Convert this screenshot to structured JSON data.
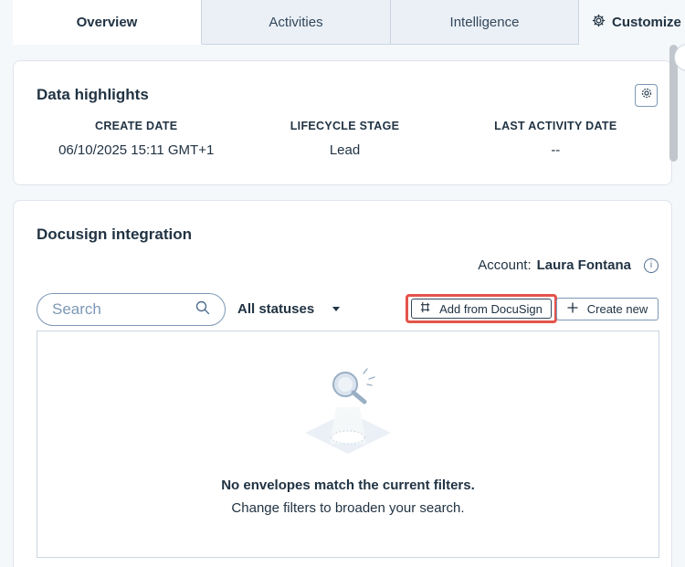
{
  "tabs": [
    {
      "label": "Overview",
      "active": true
    },
    {
      "label": "Activities",
      "active": false
    },
    {
      "label": "Intelligence",
      "active": false
    }
  ],
  "customize": {
    "label": "Customize",
    "icon": "gear-icon"
  },
  "highlights": {
    "title": "Data highlights",
    "columns": [
      {
        "label": "CREATE DATE",
        "value": "06/10/2025 15:11 GMT+1"
      },
      {
        "label": "LIFECYCLE STAGE",
        "value": "Lead"
      },
      {
        "label": "LAST ACTIVITY DATE",
        "value": "--"
      }
    ]
  },
  "docusign": {
    "title": "Docusign integration",
    "account_prefix": "Account:",
    "account_name": "Laura Fontana",
    "search_placeholder": "Search",
    "status_filter": "All statuses",
    "add_button": "Add from DocuSign",
    "create_button": "Create new",
    "empty_title": "No envelopes match the current filters.",
    "empty_subtitle": "Change filters to broaden your search."
  },
  "colors": {
    "accent_highlight": "#e4534a",
    "text_dark": "#213343",
    "border": "#cbd6e2"
  }
}
